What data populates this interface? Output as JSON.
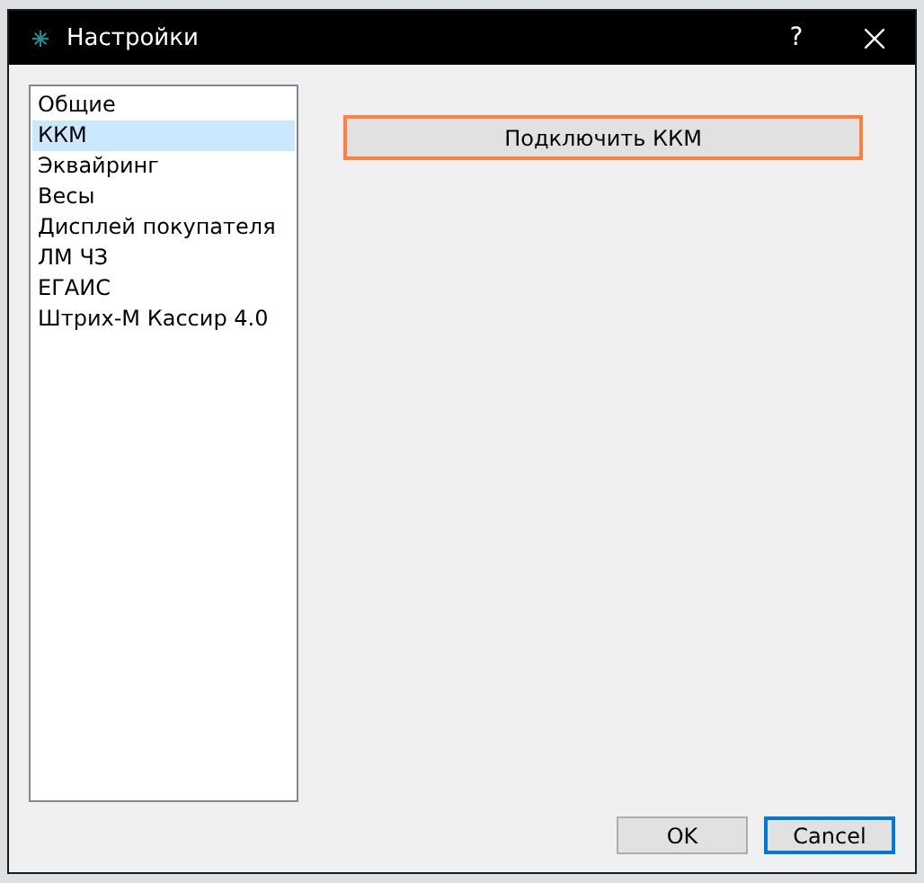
{
  "window": {
    "title": "Настройки",
    "help": "?"
  },
  "sidebar": {
    "items": [
      {
        "label": "Общие",
        "selected": false
      },
      {
        "label": "ККМ",
        "selected": true
      },
      {
        "label": "Эквайринг",
        "selected": false
      },
      {
        "label": "Весы",
        "selected": false
      },
      {
        "label": "Дисплей покупателя",
        "selected": false
      },
      {
        "label": "ЛМ ЧЗ",
        "selected": false
      },
      {
        "label": "ЕГАИС",
        "selected": false
      },
      {
        "label": "Штрих-М Кассир 4.0",
        "selected": false
      }
    ]
  },
  "connect_button": {
    "label": "Подключить ККМ",
    "highlighted": true
  },
  "buttons": [
    {
      "label": "OK",
      "focused": false
    },
    {
      "label": "Cancel",
      "focused": true
    }
  ]
}
